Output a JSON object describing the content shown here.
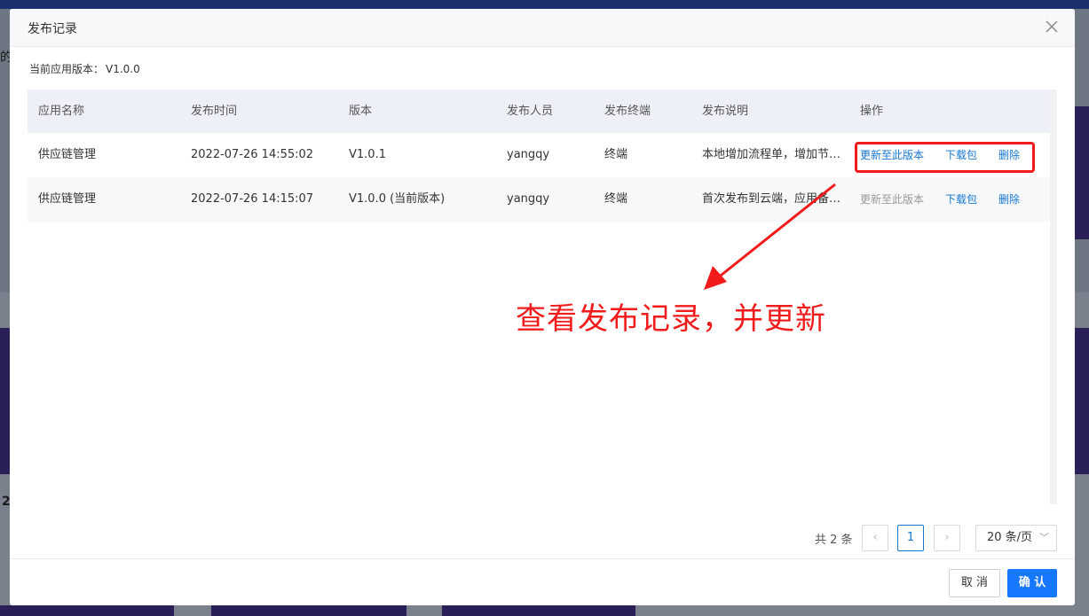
{
  "background": {
    "stub_left_1": "的",
    "stub_left_2": "2"
  },
  "dialog": {
    "title": "发布记录",
    "close_icon": "close-icon",
    "current_version_label": "当前应用版本：",
    "current_version_value": "V1.0.0"
  },
  "table": {
    "headers": [
      "应用名称",
      "发布时间",
      "版本",
      "发布人员",
      "发布终端",
      "发布说明",
      "操作"
    ],
    "rows": [
      {
        "app_name": "供应链管理",
        "time": "2022-07-26 14:55:02",
        "version": "V1.0.1",
        "publisher": "yangqy",
        "terminal": "终端",
        "description": "本地增加流程单，增加节…",
        "action_update": "更新至此版本",
        "action_download": "下载包",
        "action_delete": "删除"
      },
      {
        "app_name": "供应链管理",
        "time": "2022-07-26 14:15:07",
        "version": "V1.0.0 (当前版本)",
        "publisher": "yangqy",
        "terminal": "终端",
        "description": "首次发布到云端，应用备…",
        "action_update": "更新至此版本",
        "action_download": "下载包",
        "action_delete": "删除"
      }
    ]
  },
  "annotation": {
    "text": "查看发布记录，并更新",
    "color": "#f21b1b"
  },
  "pagination": {
    "total_text": "共 2 条",
    "current_page": "1",
    "prev_icon": "chevron-left-icon",
    "next_icon": "chevron-right-icon",
    "page_size": "20 条/页"
  },
  "footer": {
    "cancel_label": "取 消",
    "ok_label": "确 认"
  },
  "colors": {
    "accent": "#1677ff",
    "link": "#1677d2",
    "header_bg": "#edf0f6"
  }
}
